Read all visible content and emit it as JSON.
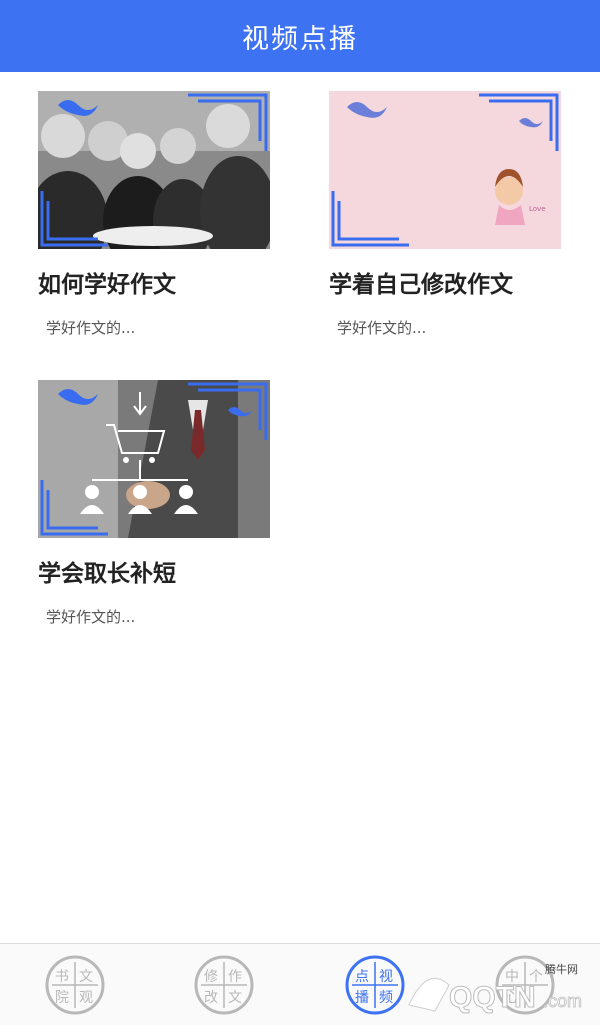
{
  "header": {
    "title": "视频点播"
  },
  "videos": [
    {
      "title": "如何学好作文",
      "desc": "学好作文的..."
    },
    {
      "title": "学着自己修改作文",
      "desc": "学好作文的..."
    },
    {
      "title": "学会取长补短",
      "desc": "学好作文的..."
    }
  ],
  "tabs": [
    {
      "chars": [
        "书",
        "文",
        "院",
        "观"
      ],
      "active": false
    },
    {
      "chars": [
        "修",
        "作",
        "改",
        "文"
      ],
      "active": false
    },
    {
      "chars": [
        "点",
        "视",
        "播",
        "频"
      ],
      "active": true
    },
    {
      "chars": [
        "中",
        "个",
        "心",
        ""
      ],
      "active": false
    }
  ],
  "watermark": {
    "logo_text": "QQTN",
    "suffix": ".com",
    "brand": "腾牛网"
  },
  "colors": {
    "accent": "#3d72f2",
    "inactive_seal": "#b8b8b8",
    "frame_blue": "#3a6cf0",
    "card2_bg": "#f5d7de"
  }
}
